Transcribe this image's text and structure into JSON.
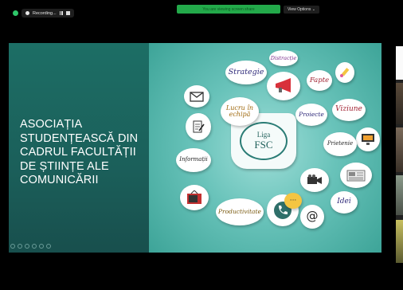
{
  "recording": {
    "label": "Recording..."
  },
  "share_banner": {
    "text": "You are viewing screen share"
  },
  "view_options": {
    "label": "View Options ⌄"
  },
  "slide": {
    "title_lines": [
      "ASOCIAȚIA",
      "STUDENȚEASCĂ DIN",
      "CADRUL FACULTĂȚII",
      "DE ȘTIINȚE ALE",
      "COMUNICĂRII"
    ],
    "bubbles": {
      "strategie": "Strategie",
      "distractie": "Distracție",
      "fapte": "Fapte",
      "lucru_in_echipa_1": "Lucru în",
      "lucru_in_echipa_2": "echipă",
      "proiecte": "Proiecte",
      "viziune": "Viziune",
      "liga_1": "Liga",
      "liga_2": "FSC",
      "prietenie": "Prietenie",
      "informatii": "Informații",
      "productivitate": "Productivitate",
      "idei": "Idei",
      "at": "@"
    }
  },
  "colors": {
    "slide_left_bg": "#1b5f5a",
    "slide_right_bg": "#69c3ba",
    "recording_green": "#2ec76a",
    "share_green": "#23a94a"
  },
  "icons": [
    "envelope-icon",
    "megaphone-icon",
    "document-pen-icon",
    "marker-icon",
    "computer-icon",
    "newspaper-icon",
    "tv-icon",
    "phone-icon",
    "video-camera-icon"
  ]
}
